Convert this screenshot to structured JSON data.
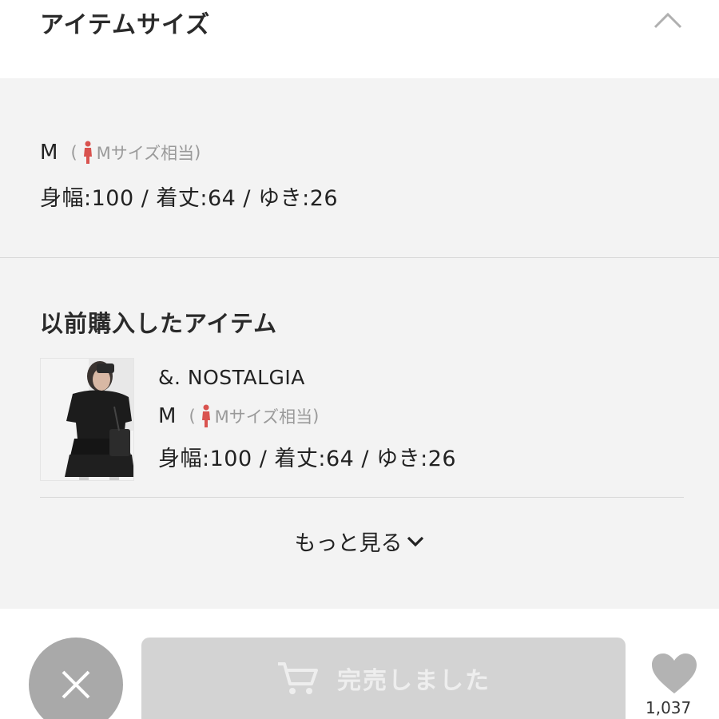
{
  "header": {
    "title": "アイテムサイズ",
    "collapse_icon": "chevron-up-icon"
  },
  "item_size": {
    "size": "M",
    "equiv_open": "(",
    "equiv_label": "Mサイズ相当",
    "equiv_close": ")",
    "measurements": "身幅:100 / 着丈:64 / ゆき:26"
  },
  "previous": {
    "title": "以前購入したアイテム",
    "items": [
      {
        "brand": "&. NOSTALGIA",
        "size": "M",
        "equiv_open": "(",
        "equiv_label": "Mサイズ相当",
        "equiv_close": ")",
        "measurements": "身幅:100 / 着丈:64 / ゆき:26"
      }
    ],
    "more_label": "もっと見る"
  },
  "footer": {
    "close_icon": "close-icon",
    "soldout_label": "完売しました",
    "cart_icon": "cart-icon",
    "heart_icon": "heart-icon",
    "like_count": "1,037"
  },
  "colors": {
    "panel_bg": "#f3f3f3",
    "person_icon": "#d9534f",
    "button_disabled": "#d3d3d3",
    "close_button": "#a9a9a9"
  }
}
